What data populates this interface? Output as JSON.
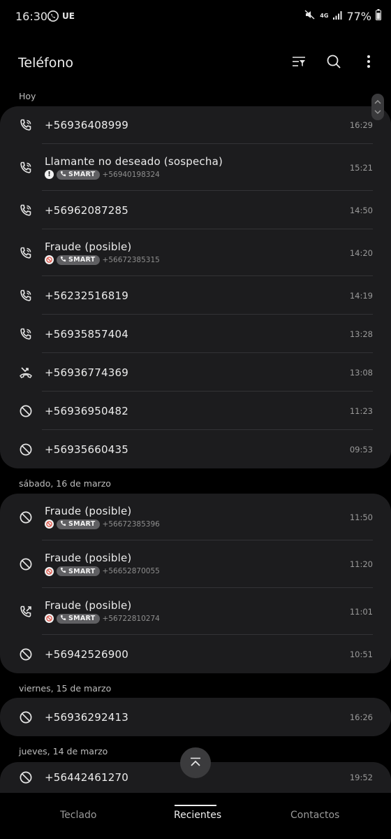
{
  "status_bar": {
    "time": "16:30",
    "carrier": "UE",
    "network": "4G",
    "battery": "77%"
  },
  "header": {
    "title": "Teléfono"
  },
  "sections": [
    {
      "label": "Hoy",
      "calls": [
        {
          "icon": "volte-call-icon",
          "name": "+56936408999",
          "time": "16:29"
        },
        {
          "icon": "volte-call-icon",
          "name": "Llamante no deseado (sospecha)",
          "badge": "warning",
          "smart": "SMART",
          "number": "+56940198324",
          "time": "15:21"
        },
        {
          "icon": "volte-call-icon",
          "name": "+56962087285",
          "time": "14:50"
        },
        {
          "icon": "volte-call-icon",
          "name": "Fraude (posible)",
          "badge": "fraud",
          "smart": "SMART",
          "number": "+56672385315",
          "time": "14:20"
        },
        {
          "icon": "volte-call-icon",
          "name": "+56232516819",
          "time": "14:19"
        },
        {
          "icon": "volte-call-icon",
          "name": "+56935857404",
          "time": "13:28"
        },
        {
          "icon": "missed-call-icon",
          "name": "+56936774369",
          "time": "13:08"
        },
        {
          "icon": "blocked-call-icon",
          "name": "+56936950482",
          "time": "11:23"
        },
        {
          "icon": "blocked-call-icon",
          "name": "+56935660435",
          "time": "09:53"
        }
      ]
    },
    {
      "label": "sábado, 16 de marzo",
      "calls": [
        {
          "icon": "blocked-call-icon",
          "name": "Fraude (posible)",
          "badge": "fraud",
          "smart": "SMART",
          "number": "+56672385396",
          "time": "11:50"
        },
        {
          "icon": "blocked-call-icon",
          "name": "Fraude (posible)",
          "badge": "fraud",
          "smart": "SMART",
          "number": "+56652870055",
          "time": "11:20"
        },
        {
          "icon": "outgoing-call-icon",
          "name": "Fraude (posible)",
          "badge": "fraud",
          "smart": "SMART",
          "number": "+56722810274",
          "time": "11:01"
        },
        {
          "icon": "blocked-call-icon",
          "name": "+56942526900",
          "time": "10:51"
        }
      ]
    },
    {
      "label": "viernes, 15 de marzo",
      "calls": [
        {
          "icon": "blocked-call-icon",
          "name": "+56936292413",
          "time": "16:26"
        }
      ]
    },
    {
      "label": "jueves, 14 de marzo",
      "calls": [
        {
          "icon": "blocked-call-icon",
          "name": "+56442461270",
          "time": "19:52"
        }
      ]
    }
  ],
  "bottom_nav": {
    "keypad": "Teclado",
    "recents": "Recientes",
    "contacts": "Contactos"
  },
  "colors": {
    "background": "#000000",
    "card": "#1c1c1e",
    "text": "#ececec",
    "secondary_text": "#9a9a9a",
    "pill": "#5f5f62"
  }
}
